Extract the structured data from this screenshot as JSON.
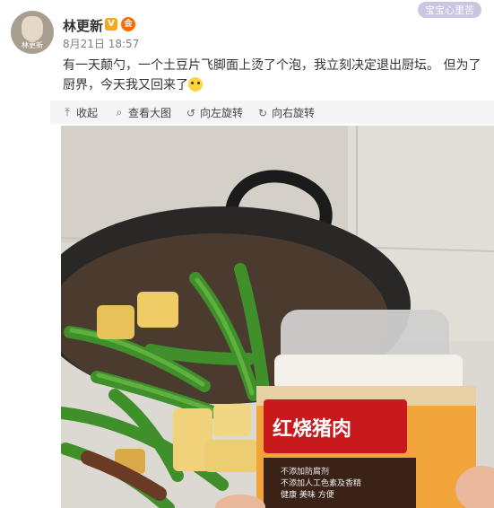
{
  "post": {
    "username": "林更新",
    "verified_badge": "V",
    "member_badge": "会",
    "avatar_label": "林更新",
    "date": "8月21日",
    "time": "18:57",
    "text": "有一天颠勺，一个土豆片飞脚面上烫了个泡，我立刻决定退出厨坛。 但为了厨界，今天我又回来了",
    "emoji": "sweat-smile-emoji"
  },
  "watermark": "宝宝心里苦",
  "toolbar": {
    "collapse": "收起",
    "view_large": "查看大图",
    "rotate_left": "向左旋转",
    "rotate_right": "向右旋转"
  },
  "photo": {
    "jar_label": "红烧猪肉",
    "jar_small_lines": [
      "不添加防腐剂",
      "不添加人工色素及香精",
      "健康  美味  方便"
    ]
  },
  "colors": {
    "accent_orange": "#f5a623",
    "toolbar_bg": "#f5f5f5",
    "jar_red": "#c8191c"
  }
}
